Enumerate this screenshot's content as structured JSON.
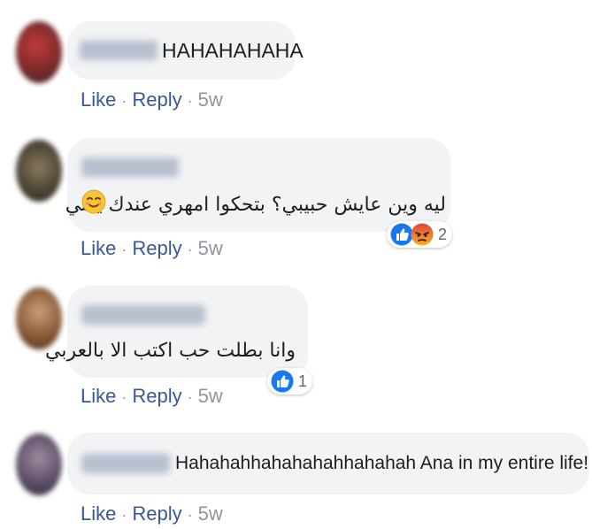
{
  "colors": {
    "bubble_bg": "#f2f3f5",
    "link": "#385898",
    "meta": "#90949c",
    "like_blue": "#1877f2",
    "angry_orange": "#e9710f"
  },
  "comments": [
    {
      "text": "HAHAHAHAHA",
      "actions": {
        "like": "Like",
        "separator": "·",
        "reply": "Reply",
        "time": "5w"
      }
    },
    {
      "text": "ليه وين عايش حبيبي؟ بتحكوا امهري عندك يعني",
      "emoji": "smiling-face-icon",
      "reactions": {
        "icons": [
          "like-icon",
          "angry-icon"
        ],
        "count": "2"
      },
      "actions": {
        "like": "Like",
        "separator": "·",
        "reply": "Reply",
        "time": "5w"
      }
    },
    {
      "text": "وانا بطلت حب اكتب الا بالعربي",
      "reactions": {
        "icons": [
          "like-icon"
        ],
        "count": "1"
      },
      "actions": {
        "like": "Like",
        "separator": "·",
        "reply": "Reply",
        "time": "5w"
      }
    },
    {
      "text": "Hahahahhahahahahhahahah Ana in my entire life!",
      "actions": {
        "like": "Like",
        "separator": "·",
        "reply": "Reply",
        "time": "5w"
      }
    }
  ]
}
